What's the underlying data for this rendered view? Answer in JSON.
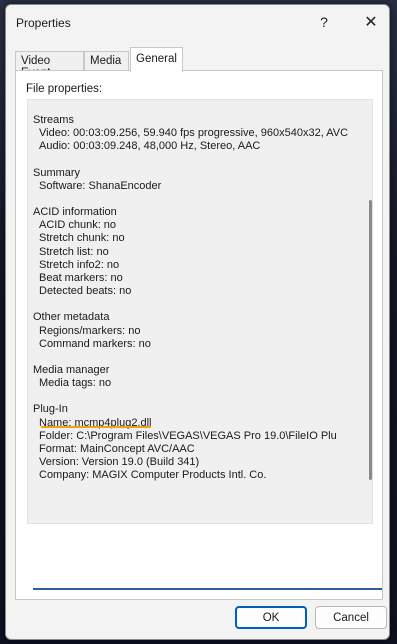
{
  "window": {
    "title": "Properties",
    "help_glyph": "?",
    "close_glyph": "✕"
  },
  "tabs": [
    {
      "label": "Video Event"
    },
    {
      "label": "Media"
    },
    {
      "label": "General"
    }
  ],
  "general": {
    "section_label": "File properties:",
    "groups": [
      {
        "head": "Streams",
        "lines": [
          "Video: 00:03:09.256, 59.940 fps progressive, 960x540x32, AVC",
          "Audio: 00:03:09.248, 48,000 Hz, Stereo, AAC"
        ]
      },
      {
        "head": "Summary",
        "lines": [
          "Software: ShanaEncoder"
        ]
      },
      {
        "head": "ACID information",
        "lines": [
          "ACID chunk: no",
          "Stretch chunk: no",
          "Stretch list: no",
          "Stretch info2: no",
          "Beat markers: no",
          "Detected beats: no"
        ]
      },
      {
        "head": "Other metadata",
        "lines": [
          "Regions/markers: no",
          "Command markers: no"
        ]
      },
      {
        "head": "Media manager",
        "lines": [
          "Media tags: no"
        ]
      },
      {
        "head": "Plug-In",
        "lines": [
          "Name: mcmp4plug2.dll",
          "Folder: C:\\Program Files\\VEGAS\\VEGAS Pro 19.0\\FileIO Plu",
          "Format: MainConcept AVC/AAC",
          "Version: Version 19.0 (Build 341)",
          "Company: MAGIX Computer Products Intl. Co."
        ]
      }
    ]
  },
  "buttons": {
    "ok": "OK",
    "cancel": "Cancel"
  },
  "colors": {
    "accent": "#005fb8",
    "highlight": "#f2a01a"
  }
}
